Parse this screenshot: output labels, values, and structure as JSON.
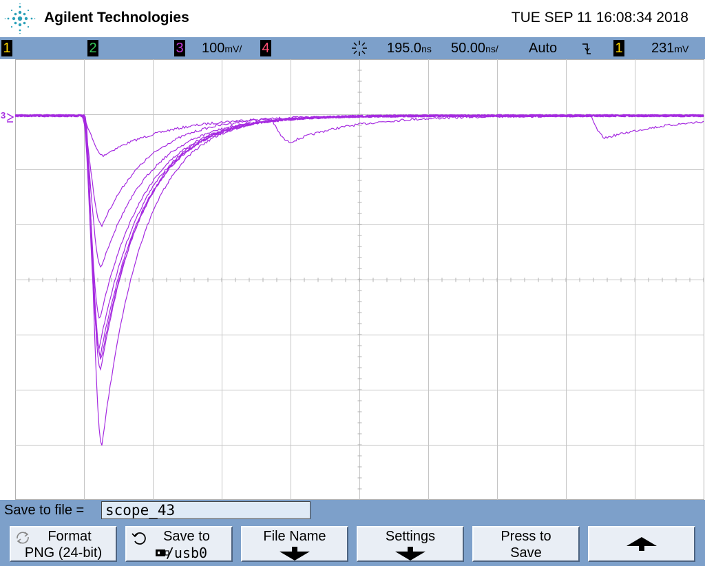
{
  "header": {
    "brand": "Agilent Technologies",
    "datetime": "TUE SEP 11 16:08:34 2018",
    "logo_icon": "agilent-spark-icon"
  },
  "statusbar": {
    "channels": [
      {
        "label": "1",
        "color": "#ffd700"
      },
      {
        "label": "2",
        "color": "#34c759"
      },
      {
        "label": "3",
        "color": "#c03ad8"
      },
      {
        "label": "4",
        "color": "#ff4f73"
      }
    ],
    "ch3_scale": "100",
    "ch3_scale_unit": "mV/",
    "time_delay": "195.0",
    "time_delay_unit": "ns",
    "time_scale": "50.00",
    "time_scale_unit": "ns/",
    "trigger_mode": "Auto",
    "trigger_slope_icon": "falling-edge-icon",
    "trigger_channel": "1",
    "trigger_level": "231",
    "trigger_level_unit": "mV",
    "acq_icon": "acquisition-run-icon"
  },
  "trace": {
    "channel_marker": "3",
    "color": "#a52ae0"
  },
  "bottom": {
    "save_label": "Save to file =",
    "filename": "scope_43",
    "softkeys": [
      {
        "line1": "Format",
        "line2": "PNG (24-bit)",
        "icon": "recycle-arrows-icon"
      },
      {
        "line1": "Save to",
        "line2": "/usb0",
        "icon": "undo-arrow-icon",
        "icon2": "usb-drive-icon"
      },
      {
        "line1": "File Name",
        "icon": "arrow-down-icon"
      },
      {
        "line1": "Settings",
        "icon": "arrow-down-icon"
      },
      {
        "line1": "Press to",
        "line2": "Save"
      },
      {
        "icon": "arrow-up-icon"
      }
    ]
  }
}
